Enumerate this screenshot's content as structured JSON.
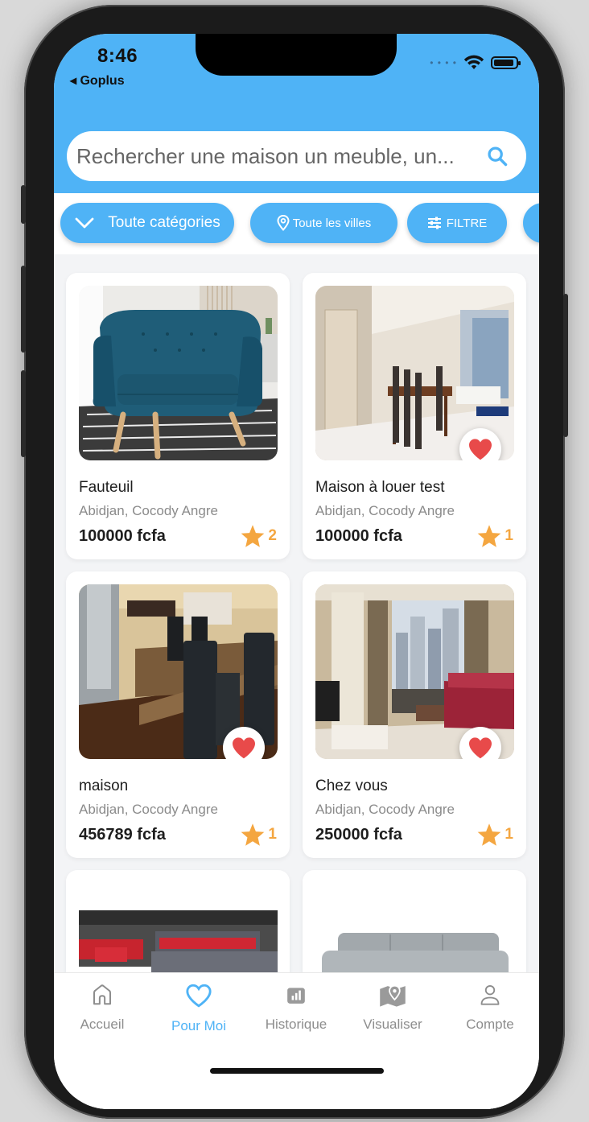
{
  "status": {
    "time": "8:46",
    "back_app": "◂ Goplus"
  },
  "search": {
    "placeholder": "Rechercher une maison un meuble, un..."
  },
  "filters": [
    {
      "label": "Toute catégories",
      "icon": "chevron-down-icon"
    },
    {
      "label": "Toute les villes",
      "icon": "location-pin-icon"
    },
    {
      "label": "FILTRE",
      "icon": "sliders-icon"
    }
  ],
  "listings": [
    {
      "title": "Fauteuil",
      "location": "Abidjan, Cocody Angre",
      "price": "100000 fcfa",
      "rating": "2",
      "favorite": false
    },
    {
      "title": "Maison à louer test",
      "location": "Abidjan, Cocody Angre",
      "price": "100000 fcfa",
      "rating": "1",
      "favorite": true
    },
    {
      "title": "maison",
      "location": "Abidjan, Cocody Angre",
      "price": "456789 fcfa",
      "rating": "1",
      "favorite": true
    },
    {
      "title": "Chez vous",
      "location": "Abidjan, Cocody Angre",
      "price": "250000 fcfa",
      "rating": "1",
      "favorite": true
    }
  ],
  "nav": [
    {
      "label": "Accueil",
      "icon": "home-icon",
      "active": false
    },
    {
      "label": "Pour Moi",
      "icon": "heart-icon",
      "active": true
    },
    {
      "label": "Historique",
      "icon": "chart-icon",
      "active": false
    },
    {
      "label": "Visualiser",
      "icon": "map-pin-icon",
      "active": false
    },
    {
      "label": "Compte",
      "icon": "user-icon",
      "active": false
    }
  ],
  "colors": {
    "accent": "#4fb3f6",
    "star": "#f4a640",
    "heart": "#e84a4a"
  }
}
